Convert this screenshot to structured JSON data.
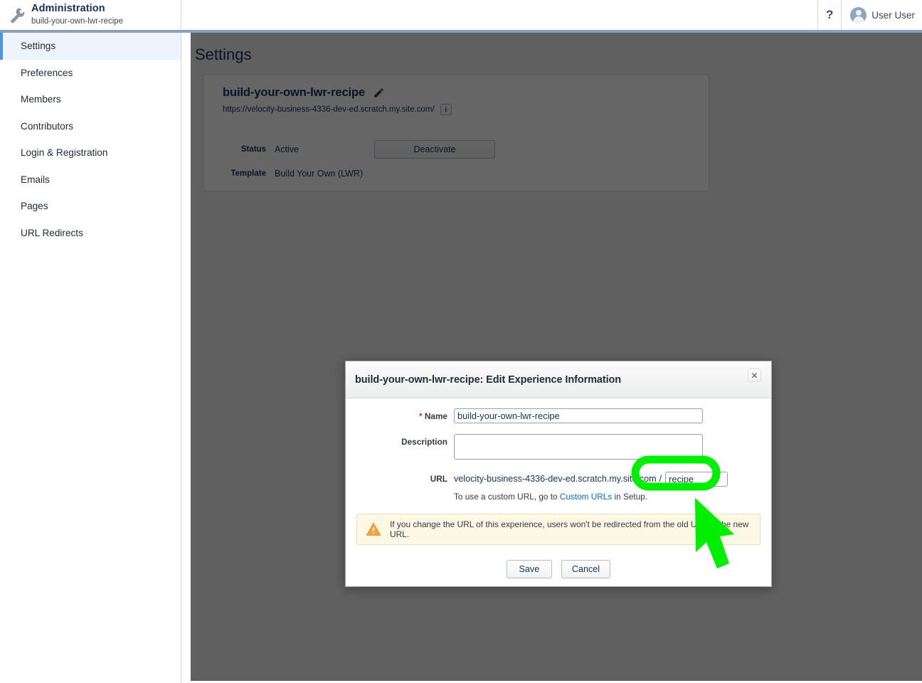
{
  "header": {
    "brand_title": "Administration",
    "brand_subtitle": "build-your-own-lwr-recipe",
    "wrench_icon": "wrench-icon",
    "help_label": "?",
    "user_name": "User User",
    "avatar_icon": "user-avatar-icon"
  },
  "sidebar": {
    "items": [
      {
        "label": "Settings",
        "active": true
      },
      {
        "label": "Preferences",
        "active": false
      },
      {
        "label": "Members",
        "active": false
      },
      {
        "label": "Contributors",
        "active": false
      },
      {
        "label": "Login & Registration",
        "active": false
      },
      {
        "label": "Emails",
        "active": false
      },
      {
        "label": "Pages",
        "active": false
      },
      {
        "label": "URL Redirects",
        "active": false
      }
    ]
  },
  "main": {
    "page_title": "Settings",
    "card": {
      "title": "build-your-own-lwr-recipe",
      "edit_icon": "pencil-icon",
      "url": "https://velocity-business-4336-dev-ed.scratch.my.site.com/",
      "info_icon": "info-icon",
      "info_label": "i",
      "status_label": "Status",
      "status_value": "Active",
      "deactivate_label": "Deactivate",
      "template_label": "Template",
      "template_value": "Build Your Own (LWR)"
    }
  },
  "modal": {
    "title": "build-your-own-lwr-recipe: Edit Experience Information",
    "close_icon": "close-icon",
    "close_label": "✕",
    "name_label": "Name",
    "name_required_marker": "*",
    "name_value": "build-your-own-lwr-recipe",
    "name_placeholder": "",
    "description_label": "Description",
    "description_value": "",
    "description_placeholder": "",
    "url_label": "URL",
    "url_domain": "velocity-business-4336-dev-ed.scratch.my.site.com",
    "url_separator": "/",
    "url_path_value": "recipe",
    "url_path_placeholder": "",
    "url_help_prefix": "To use a custom URL, go to ",
    "url_help_link": "Custom URLs",
    "url_help_suffix": " in Setup.",
    "warning_icon": "warning-triangle-icon",
    "warning_text": "If you change the URL of this experience, users won't be redirected from the old URL to the new URL.",
    "save_label": "Save",
    "cancel_label": "Cancel"
  },
  "annotation": {
    "highlight_icon": "green-ellipse-highlight",
    "arrow_icon": "green-arrow-pointer",
    "color": "#00EE00",
    "target": "url-path-input"
  },
  "colors": {
    "accent_blue": "#4e94e0",
    "brand_navy": "#16325c",
    "header_rule": "#8ca0be",
    "active_nav_bg": "#eef4fd",
    "page_bg": "#efefef",
    "warning_bg": "#fcf8e3",
    "warning_icon": "#f3a847",
    "link": "#0070d2",
    "required": "#c23934",
    "annotation_green": "#00EE00"
  }
}
